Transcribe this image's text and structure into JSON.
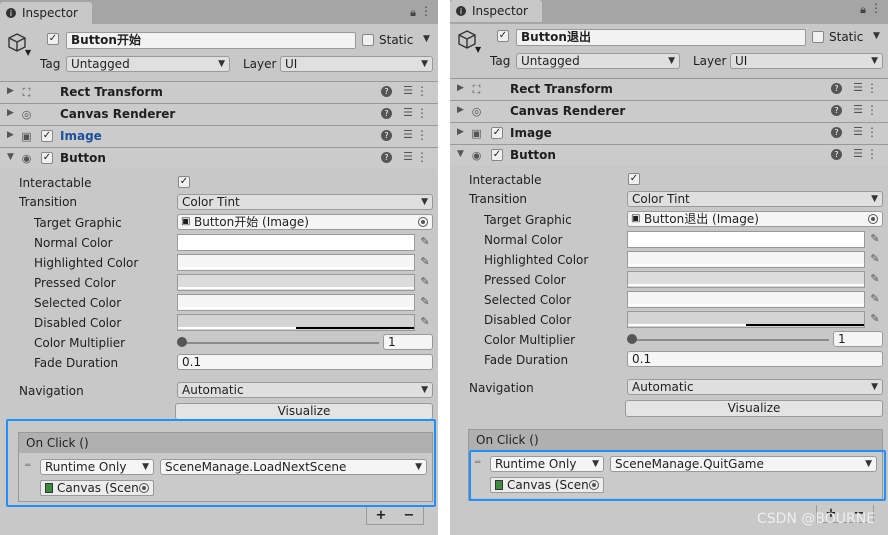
{
  "panels": [
    {
      "tab_title": "Inspector",
      "object_name": "Button开始",
      "static_label": "Static",
      "tag_label": "Tag",
      "tag_value": "Untagged",
      "layer_label": "Layer",
      "layer_value": "UI",
      "components": [
        "Rect Transform",
        "Canvas Renderer",
        "Image",
        "Button"
      ],
      "props": {
        "interactable": "Interactable",
        "transition": "Transition",
        "transition_value": "Color Tint",
        "target_graphic": "Target Graphic",
        "target_graphic_value": "Button开始 (Image)",
        "normal_color": "Normal Color",
        "highlighted_color": "Highlighted Color",
        "pressed_color": "Pressed Color",
        "selected_color": "Selected Color",
        "disabled_color": "Disabled Color",
        "color_multiplier": "Color Multiplier",
        "color_multiplier_value": "1",
        "fade_duration": "Fade Duration",
        "fade_duration_value": "0.1",
        "navigation": "Navigation",
        "navigation_value": "Automatic",
        "visualize": "Visualize"
      },
      "on_click": {
        "header": "On Click ()",
        "runtime": "Runtime Only",
        "function": "SceneManage.LoadNextScene",
        "object": "Canvas (Scene"
      },
      "plus": "+",
      "minus": "−"
    },
    {
      "tab_title": "Inspector",
      "object_name": "Button退出",
      "static_label": "Static",
      "tag_label": "Tag",
      "tag_value": "Untagged",
      "layer_label": "Layer",
      "layer_value": "UI",
      "components": [
        "Rect Transform",
        "Canvas Renderer",
        "Image",
        "Button"
      ],
      "props": {
        "interactable": "Interactable",
        "transition": "Transition",
        "transition_value": "Color Tint",
        "target_graphic": "Target Graphic",
        "target_graphic_value": "Button退出 (Image)",
        "normal_color": "Normal Color",
        "highlighted_color": "Highlighted Color",
        "pressed_color": "Pressed Color",
        "selected_color": "Selected Color",
        "disabled_color": "Disabled Color",
        "color_multiplier": "Color Multiplier",
        "color_multiplier_value": "1",
        "fade_duration": "Fade Duration",
        "fade_duration_value": "0.1",
        "navigation": "Navigation",
        "navigation_value": "Automatic",
        "visualize": "Visualize"
      },
      "on_click": {
        "header": "On Click ()",
        "runtime": "Runtime Only",
        "function": "SceneManage.QuitGame",
        "object": "Canvas (Scene"
      },
      "plus": "+",
      "minus": "−"
    }
  ],
  "watermark": "CSDN @BOURNE",
  "colors": {
    "highlight": "#1e90ff",
    "image_title": "#1c4f9c",
    "panel_bg": "#c8c8c8"
  }
}
